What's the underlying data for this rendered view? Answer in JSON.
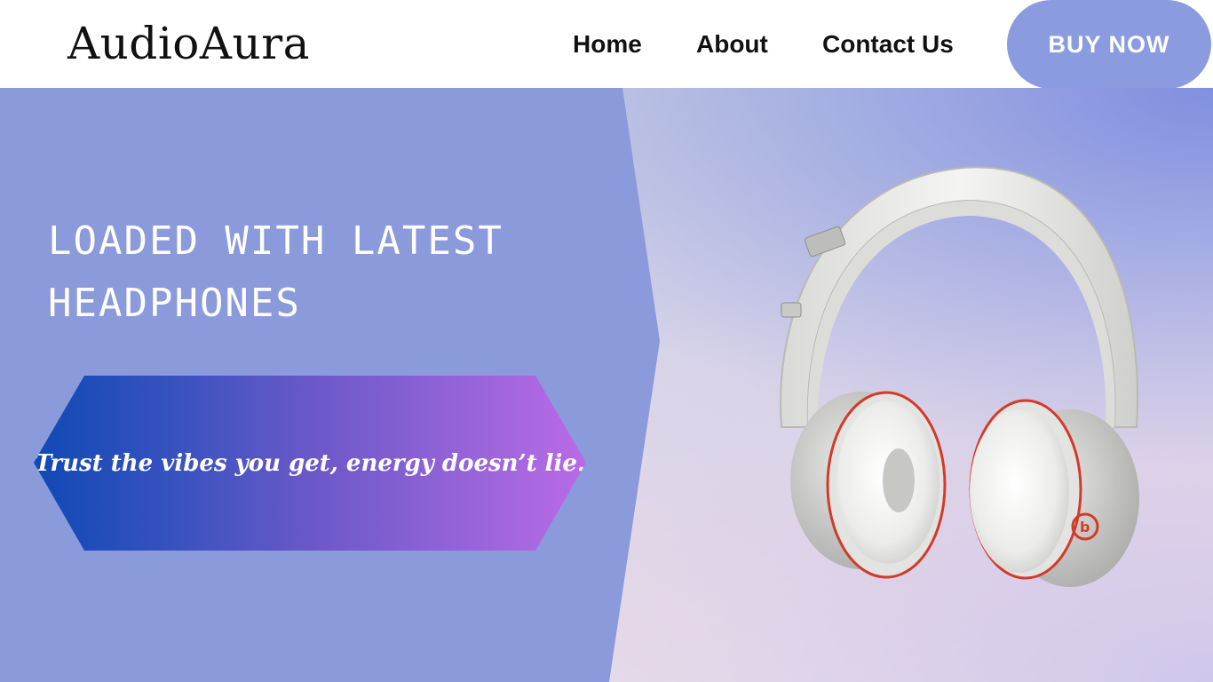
{
  "header": {
    "logo": "AudioAura",
    "nav": [
      {
        "label": "Home"
      },
      {
        "label": "About"
      },
      {
        "label": "Contact Us"
      }
    ],
    "cta_label": "BUY NOW"
  },
  "hero": {
    "headline_line1": "LOADED WITH LATEST",
    "headline_line2": "HEADPHONES",
    "tagline": "Trust the vibes you get, energy doesn’t lie.",
    "image_subject": "headphones-image"
  },
  "colors": {
    "accent": "#8b9be0",
    "hero_left": "#8b9adb",
    "gradient_start": "#0f49b5",
    "gradient_end": "#ba6ae6",
    "text_dark": "#111111",
    "text_light": "#ffffff"
  }
}
